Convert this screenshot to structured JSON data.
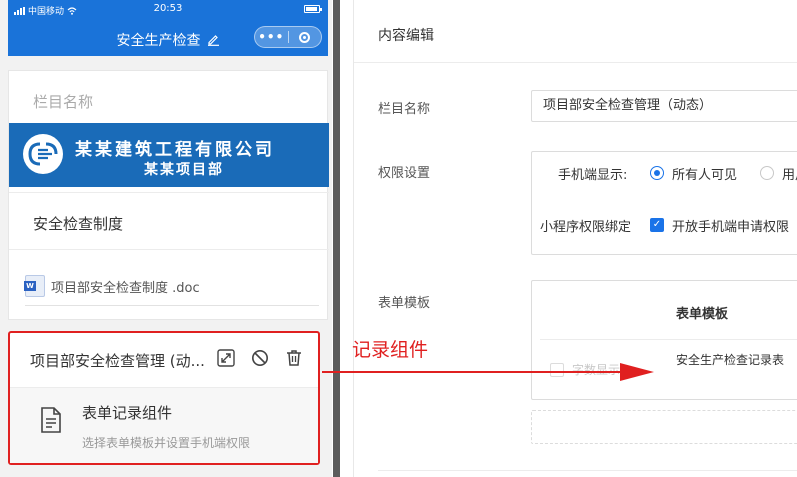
{
  "status_bar": {
    "carrier": "中国移动",
    "time": "20:53"
  },
  "nav": {
    "title": "安全生产检查",
    "more": "•••"
  },
  "preview": {
    "column_name_placeholder": "栏目名称",
    "banner": {
      "company": "某某建筑工程有限公司",
      "project": "某某项目部"
    },
    "section_title": "安全检查制度",
    "doc_file": "项目部安全检查制度 .doc",
    "selected_card": {
      "title": "项目部安全检查管理 (动...",
      "form_component": "表单记录组件",
      "form_description": "选择表单模板并设置手机端权限"
    }
  },
  "editor": {
    "title": "内容编辑",
    "column_name_label": "栏目名称",
    "column_name_value": "项目部安全检查管理（动态）",
    "permission_label": "权限设置",
    "mobile_display_label": "手机端显示:",
    "mobile_display_options": [
      "所有人可见",
      "用户"
    ],
    "mobile_display_selected": "所有人可见",
    "mini_program_label": "小程序权限绑定",
    "mini_program_option": "开放手机端申请权限",
    "form_template_label": "表单模板",
    "table_header": "表单模板",
    "table_row_check_label": "字数显示",
    "table_row_name": "安全生产检查记录表"
  },
  "annotation": {
    "label": "记录组件",
    "color": "#e02020"
  },
  "colors": {
    "brand_blue": "#1a73d9",
    "banner_blue": "#1a6bb8",
    "accent": "#1a73e8",
    "highlight_red": "#e02020"
  }
}
